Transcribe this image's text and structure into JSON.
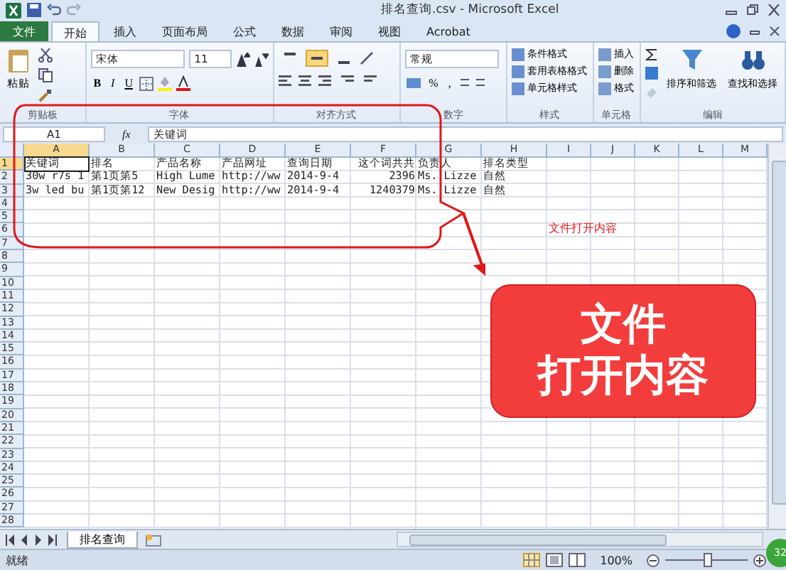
{
  "window": {
    "title": "排名查询.csv - Microsoft Excel"
  },
  "tabs": [
    {
      "label": "文件",
      "kind": "file",
      "selected": false
    },
    {
      "label": "开始",
      "kind": "tab",
      "selected": true
    },
    {
      "label": "插入",
      "kind": "tab",
      "selected": false
    },
    {
      "label": "页面布局",
      "kind": "tab",
      "selected": false
    },
    {
      "label": "公式",
      "kind": "tab",
      "selected": false
    },
    {
      "label": "数据",
      "kind": "tab",
      "selected": false
    },
    {
      "label": "审阅",
      "kind": "tab",
      "selected": false
    },
    {
      "label": "视图",
      "kind": "tab",
      "selected": false
    },
    {
      "label": "Acrobat",
      "kind": "tab",
      "selected": false
    }
  ],
  "ribbon": {
    "clipboard": {
      "paste": "粘贴",
      "label": "剪贴板"
    },
    "font": {
      "name": "宋体",
      "size": "11",
      "bold": "B",
      "italic": "I",
      "underline": "U",
      "label": "字体"
    },
    "alignment": {
      "buttons": [
        {
          "selected": false
        },
        {
          "selected": true
        },
        {
          "selected": false
        }
      ],
      "label": "对齐方式"
    },
    "number": {
      "format": "常规",
      "percent": "%",
      "comma": ",",
      "label": "数字"
    },
    "styles": {
      "items": [
        "条件格式",
        "套用表格格式",
        "单元格样式"
      ],
      "label": "样式"
    },
    "cells": {
      "items": [
        "插入",
        "删除",
        "格式"
      ],
      "label": "单元格"
    },
    "editing": {
      "items": [
        "排序和筛选",
        "查找和选择"
      ],
      "label": "编辑"
    }
  },
  "formula_bar": {
    "name_box": "A1",
    "fx": "fx",
    "value": "关键词"
  },
  "sheet": {
    "column_headers": [
      "A",
      "B",
      "C",
      "D",
      "E",
      "F",
      "G",
      "H",
      "I",
      "J",
      "K",
      "L",
      "M"
    ],
    "row_headers": [
      "1",
      "2",
      "3",
      "4",
      "5",
      "6",
      "7",
      "8",
      "9",
      "10",
      "11",
      "12",
      "13",
      "14",
      "15",
      "16",
      "17",
      "18",
      "19",
      "20",
      "21",
      "22",
      "23",
      "24",
      "25",
      "26",
      "27",
      "28"
    ],
    "rows": [
      [
        "关键词",
        "排名",
        "产品名称",
        "产品网址",
        "查询日期",
        "这个词共共",
        "负责人",
        "排名类型"
      ],
      [
        "30w r7s 1",
        "第1页第5",
        "High Lume",
        "http://ww",
        "2014-9-4",
        "2396",
        "Ms. Lizze",
        "自然"
      ],
      [
        "3w led bu",
        "第1页第12",
        "New Desig",
        "http://ww",
        "2014-9-4",
        "1240379",
        "Ms. Lizze",
        "自然"
      ]
    ],
    "note": "文件打开内容"
  },
  "callout": {
    "lines": [
      "文件",
      "打开内容"
    ]
  },
  "sheet_tabs": [
    {
      "label": "排名查询",
      "selected": true
    }
  ],
  "status_bar": {
    "status": "就绪",
    "zoom": "100%",
    "level": 0.5
  },
  "badge": "32"
}
